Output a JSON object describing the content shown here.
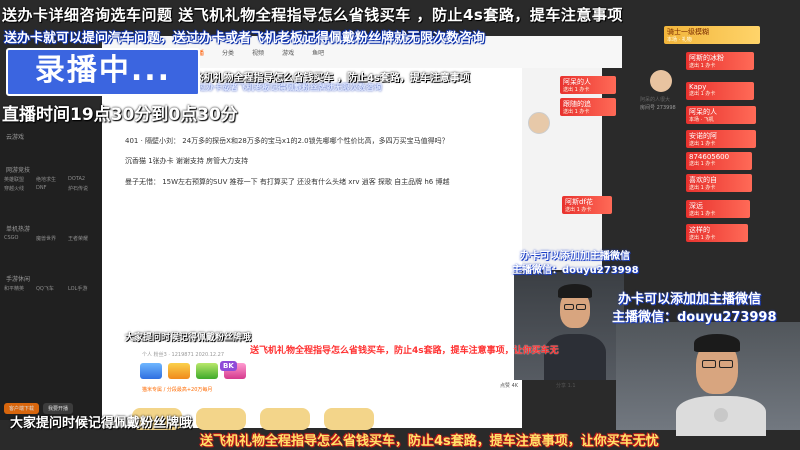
{
  "overlay": {
    "top_line_1": "送办卡详细咨询选车问题  送飞机礼物全程指导怎么省钱买车 ，防止4s套路，提车注意事项",
    "top_line_2": "送办卡就可以提问汽车问题，送过办卡或者飞机老板记得佩戴粉丝牌就无限次数咨询",
    "recording_label": "录播中...",
    "mid_line": "询选车问题  送飞机礼物全程指导怎么省钱买车 ，防止4s套路，提车注意事项",
    "mid_small": "就可以提问汽车问题，送过办卡或者飞机老板记得佩戴粉丝牌就无限次数咨询",
    "schedule": "直播时间19点30分到0点30分",
    "fan_reminder_small": "大家提问时候记得佩戴粉丝牌哦",
    "red_marquee": "送飞机礼物全程指导怎么省钱买车，防止4s套路，提车注意事项，让你买车无",
    "fan_reminder": "大家提问时候记得佩戴粉丝牌哦",
    "bottom_marquee": "送飞机礼物全程指导怎么省钱买车，防止4s套路，提车注意事项，让你买车无忧",
    "wechat_small_1": "办卡可以添加加主播微信",
    "wechat_small_2": "主播微信：douyu273998",
    "wechat_big_1": "办卡可以添加加主播微信",
    "wechat_big_2": "主播微信：douyu273998"
  },
  "browser": {
    "nav": [
      "首页",
      "直播",
      "分类",
      "视频",
      "游戏",
      "鱼吧"
    ],
    "active_nav": "直播"
  },
  "chat": {
    "line1": "401 · 隔壁小刘：  24万多的探岳X和28万多的宝马x1的2.0锁先哪哪个性价比高，多四万买宝马值得吗？",
    "line2": "沉香猫    1张办卡  谢谢支持  房管大力支持",
    "line3": "曼子无惜：  15W左右预算的SUV  推荐一下   有打算买了  还没有什么头绪    xrv  逍客  探歌  自主品牌  h6  博越",
    "meta": "个人 粉丝3 · 1219871 2020.12.27",
    "bk": "BK",
    "subinfo": "猫米专属 / 分段最高+20万每月",
    "count_a": "点赞 4K",
    "count_b": "分享 1.1"
  },
  "sidebar": {
    "follow": "云游戏",
    "sections": [
      "网游竞技",
      "单机热游",
      "手游休闲"
    ],
    "games": [
      "英雄联盟",
      "绝地求生",
      "DOTA2",
      "穿越火线",
      "DNF",
      "炉石传说",
      "CSGO",
      "魔兽世界",
      "王者荣耀",
      "和平精英",
      "QQ飞车",
      "LOL手游"
    ],
    "btn_left": "客户端下载",
    "btn_right": "我要开播"
  },
  "notifications": [
    {
      "text": "骑士一级模糊",
      "sub": "本场 · 礼物"
    },
    {
      "text": "阿呆的人",
      "sub": "送出 1 办卡"
    },
    {
      "text": "阿斯的冰粉",
      "sub": "送出 1 办卡"
    },
    {
      "text": "跟随的追",
      "sub": "送出 1 办卡"
    },
    {
      "text": "Kapy",
      "sub": "送出 1 办卡"
    },
    {
      "text": "阿呆的人",
      "sub": "本场 · 飞机"
    },
    {
      "text": "安诺的阿",
      "sub": "送出 1 办卡"
    },
    {
      "text": "874605600",
      "sub": "送出 1 办卡"
    },
    {
      "text": "喜欢的自",
      "sub": "送出 1 办卡"
    },
    {
      "text": "阿斯df花",
      "sub": "送出 1 办卡"
    },
    {
      "text": "深远",
      "sub": "送出 1 办卡"
    },
    {
      "text": "这样的",
      "sub": "送出 1 办卡"
    }
  ],
  "host_card": {
    "name": "阿呆的人很大",
    "id": "房间号 273998"
  }
}
